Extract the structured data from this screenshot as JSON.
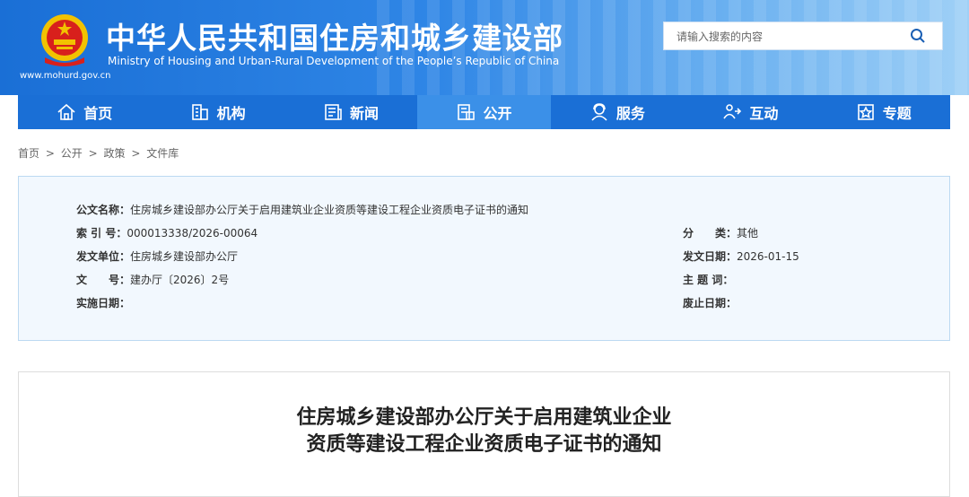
{
  "header": {
    "title_cn": "中华人民共和国住房和城乡建设部",
    "title_en": "Ministry of Housing and Urban-Rural Development of the People’s Republic of China",
    "site_url": "www.mohurd.gov.cn",
    "search_placeholder": "请输入搜索的内容"
  },
  "nav": [
    {
      "label": "首页",
      "icon": "home-icon"
    },
    {
      "label": "机构",
      "icon": "building-icon"
    },
    {
      "label": "新闻",
      "icon": "news-icon"
    },
    {
      "label": "公开",
      "icon": "document-icon"
    },
    {
      "label": "服务",
      "icon": "service-icon"
    },
    {
      "label": "互动",
      "icon": "interaction-icon"
    },
    {
      "label": "专题",
      "icon": "topic-icon"
    }
  ],
  "breadcrumb": [
    "首页",
    ">",
    "公开",
    ">",
    "政策",
    ">",
    "文件库"
  ],
  "info": {
    "doc_name_label": "公文名称：",
    "doc_name": "住房城乡建设部办公厅关于启用建筑业企业资质等建设工程企业资质电子证书的通知",
    "index_label": "索 引 号：",
    "index": "000013338/2026-00064",
    "category_label": "分　　类：",
    "category": "其他",
    "issuer_label": "发文单位：",
    "issuer": "住房城乡建设部办公厅",
    "date_label": "发文日期：",
    "date": "2026-01-15",
    "docno_label": "文　　号：",
    "docno": "建办厅〔2026〕2号",
    "keywords_label": "主 题 词：",
    "keywords": "",
    "effective_label": "实施日期：",
    "effective": "",
    "expire_label": "废止日期：",
    "expire": ""
  },
  "article": {
    "title_line1": "住房城乡建设部办公厅关于启用建筑业企业",
    "title_line2": "资质等建设工程企业资质电子证书的通知"
  }
}
